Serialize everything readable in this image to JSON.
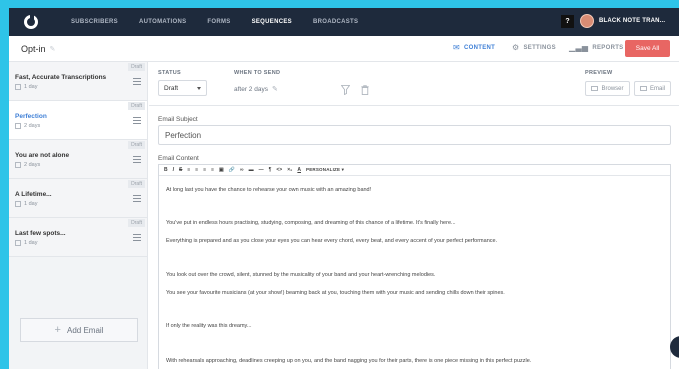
{
  "nav": {
    "items": [
      {
        "label": "SUBSCRIBERS",
        "active": false
      },
      {
        "label": "AUTOMATIONS",
        "active": false
      },
      {
        "label": "FORMS",
        "active": false
      },
      {
        "label": "SEQUENCES",
        "active": true
      },
      {
        "label": "BROADCASTS",
        "active": false
      }
    ],
    "help": "?",
    "account_name": "BLACK NOTE TRAN..."
  },
  "header": {
    "title": "Opt-in",
    "tabs": [
      {
        "label": "CONTENT",
        "icon": "mail-icon",
        "active": true
      },
      {
        "label": "SETTINGS",
        "icon": "gear-icon",
        "active": false
      },
      {
        "label": "REPORTS",
        "icon": "bar-chart-icon",
        "active": false
      }
    ],
    "save_label": "Save All"
  },
  "sidebar": {
    "emails": [
      {
        "name": "Fast, Accurate Transcriptions",
        "delay": "1 day",
        "status": "Draft",
        "active": false
      },
      {
        "name": "Perfection",
        "delay": "2 days",
        "status": "Draft",
        "active": true
      },
      {
        "name": "You are not alone",
        "delay": "2 days",
        "status": "Draft",
        "active": false
      },
      {
        "name": "A Lifetime...",
        "delay": "1 day",
        "status": "Draft",
        "active": false
      },
      {
        "name": "Last few spots...",
        "delay": "1 day",
        "status": "Draft",
        "active": false
      }
    ],
    "add_label": "Add Email"
  },
  "editor": {
    "status_label": "STATUS",
    "status_value": "Draft",
    "when_label": "WHEN TO SEND",
    "when_value": "after 2 days",
    "preview_label": "PREVIEW",
    "preview_browser": "Browser",
    "preview_email": "Email",
    "subject_label": "Email Subject",
    "subject_value": "Perfection",
    "content_label": "Email Content",
    "toolbar": [
      "B",
      "I",
      "S",
      "≡",
      "≡",
      "≡",
      "≡",
      "▣",
      "🔗",
      "∞",
      "▬",
      "—",
      "¶",
      "<>",
      "×₂",
      "A"
    ],
    "personalize": "PERSONALIZE ▾",
    "paragraphs": [
      "At long last you have the chance to rehearse your own music with an amazing band!",
      "You've put in endless hours practising, studying, composing, and dreaming of this chance of a lifetime. It's finally here...",
      "Everything is prepared and as you close your eyes you can hear every chord, every beat, and every accent of your perfect performance.",
      "You look out over the crowd, silent, stunned by the musicality of your band and your heart-wrenching melodies.",
      "You see your favourite musicians (at your show!) beaming back at you, touching them with your music and sending chills down their spines.",
      "If only the reality was this dreamy...",
      "With rehearsals approaching, deadlines creeping up on you, and the band nagging you for their parts, there is one piece missing in this perfect puzzle."
    ]
  }
}
